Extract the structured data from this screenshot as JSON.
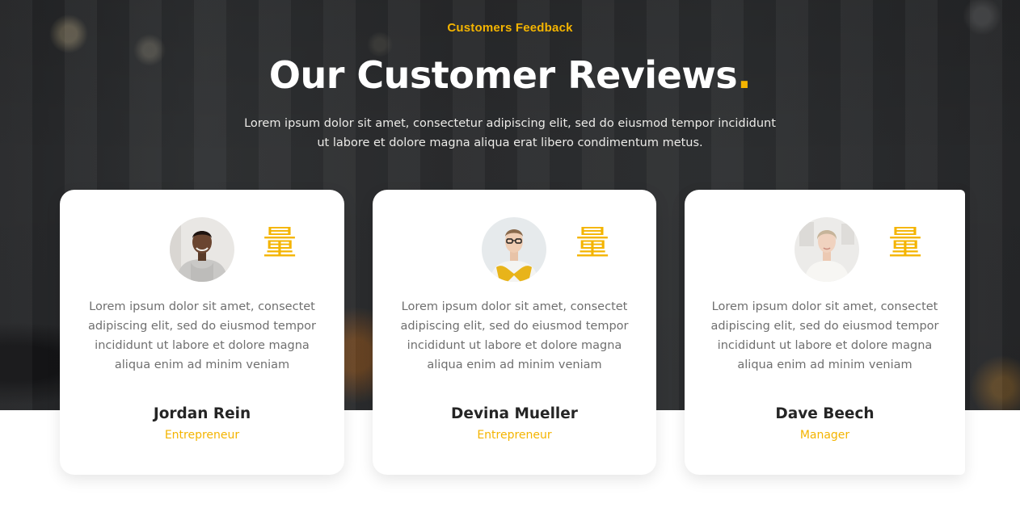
{
  "section": {
    "eyebrow": "Customers Feedback",
    "title": "Our Customer Reviews",
    "title_accent": ".",
    "subtitle": "Lorem ipsum dolor sit amet, consectetur adipiscing elit, sed do eiusmod tempor incididunt ut labore et dolore magna aliqua erat libero condimentum metus."
  },
  "colors": {
    "accent": "#f4b400",
    "hero_background": "#2c2d2f",
    "card_background": "#ffffff",
    "heading_text": "#ffffff",
    "body_text": "#6f6f6f",
    "name_text": "#252525"
  },
  "reviews": [
    {
      "avatar_icon": "customer-photo-man-grey-hoodie",
      "quote_icon": "quote-icon",
      "quote_glyph": "量",
      "text": "Lorem ipsum dolor sit amet, consectet adipiscing elit, sed do eiusmod tempor incididunt ut labore et dolore magna aliqua enim ad minim veniam",
      "name": "Jordan Rein",
      "role": "Entrepreneur"
    },
    {
      "avatar_icon": "customer-photo-man-glasses-yellow-sweater",
      "quote_icon": "quote-icon",
      "quote_glyph": "量",
      "text": "Lorem ipsum dolor sit amet, consectet adipiscing elit, sed do eiusmod tempor incididunt ut labore et dolore magna aliqua enim ad minim veniam",
      "name": "Devina Mueller",
      "role": "Entrepreneur"
    },
    {
      "avatar_icon": "customer-photo-woman-white-blouse",
      "quote_icon": "quote-icon",
      "quote_glyph": "量",
      "text": "Lorem ipsum dolor sit amet, consectet adipiscing elit, sed do eiusmod tempor incididunt ut labore et dolore magna aliqua enim ad minim veniam",
      "name": "Dave Beech",
      "role": "Manager"
    }
  ]
}
